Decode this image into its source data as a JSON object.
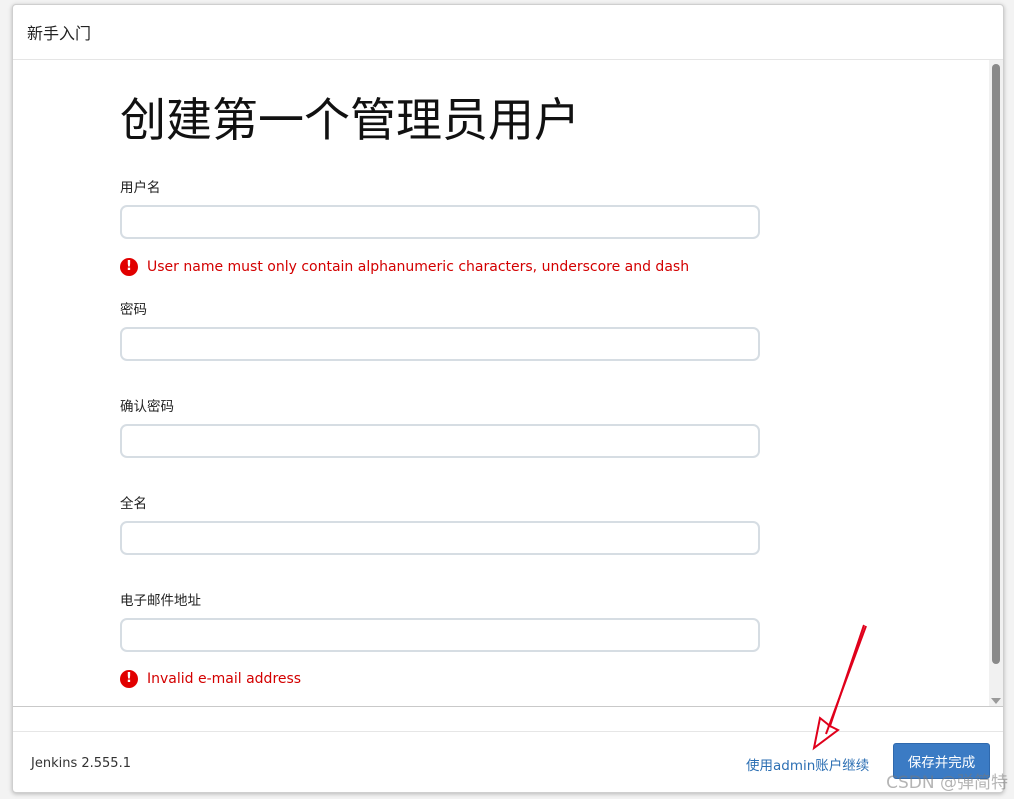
{
  "dialog": {
    "title": "新手入门"
  },
  "form": {
    "heading": "创建第一个管理员用户",
    "fields": [
      {
        "label": "用户名",
        "value": "",
        "error": "User name must only contain alphanumeric characters, underscore and dash"
      },
      {
        "label": "密码",
        "value": ""
      },
      {
        "label": "确认密码",
        "value": ""
      },
      {
        "label": "全名",
        "value": ""
      },
      {
        "label": "电子邮件地址",
        "value": "",
        "error": "Invalid e-mail address"
      }
    ],
    "error_icon": "!"
  },
  "footer": {
    "version": "Jenkins 2.555.1",
    "continue_link": "使用admin账户继续",
    "save_button": "保存并完成"
  },
  "annotation": {
    "color": "#e0001b"
  },
  "watermark": "CSDN @弹简特",
  "colors": {
    "error": "#d30000",
    "link": "#2c6fb3",
    "primary_button": "#3b7bc4"
  }
}
